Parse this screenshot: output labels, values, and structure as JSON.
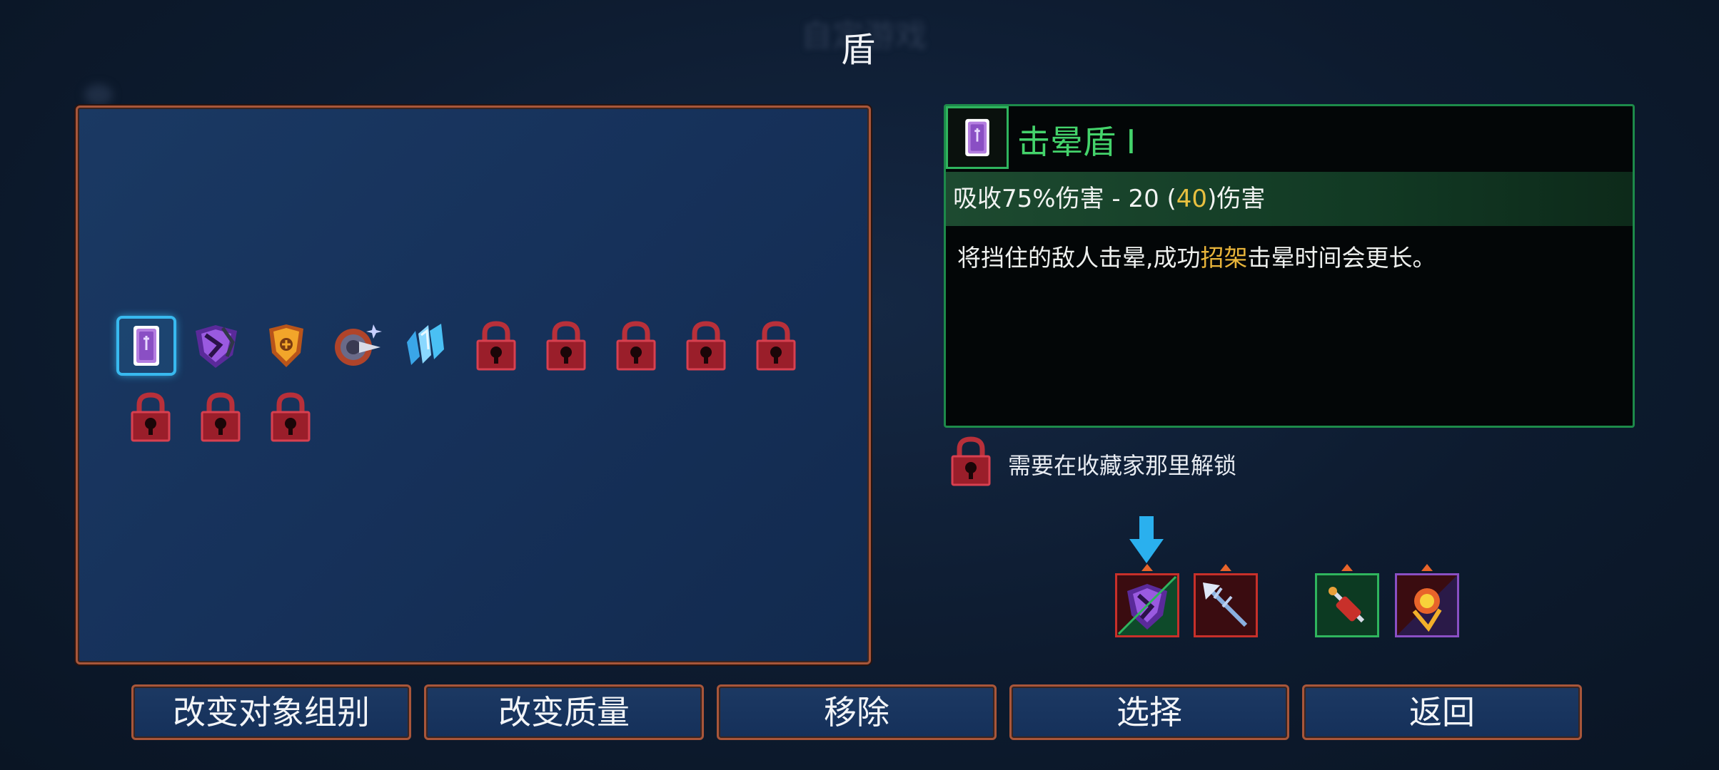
{
  "header": {
    "title": "盾"
  },
  "grid": {
    "items": [
      {
        "id": "stun-shield",
        "name": "stun-shield-icon",
        "locked": false,
        "selected": true
      },
      {
        "id": "shield-2",
        "name": "dark-purple-shield-icon",
        "locked": false
      },
      {
        "id": "shield-3",
        "name": "gold-shield-icon",
        "locked": false
      },
      {
        "id": "shield-4",
        "name": "spiked-round-shield-icon",
        "locked": false
      },
      {
        "id": "shield-5",
        "name": "ice-shield-icon",
        "locked": false
      },
      {
        "id": "lock-1",
        "name": "locked-slot-icon",
        "locked": true
      },
      {
        "id": "lock-2",
        "name": "locked-slot-icon",
        "locked": true
      },
      {
        "id": "lock-3",
        "name": "locked-slot-icon",
        "locked": true
      },
      {
        "id": "lock-4",
        "name": "locked-slot-icon",
        "locked": true
      },
      {
        "id": "lock-5",
        "name": "locked-slot-icon",
        "locked": true
      },
      {
        "id": "lock-6",
        "name": "locked-slot-icon",
        "locked": true
      },
      {
        "id": "lock-7",
        "name": "locked-slot-icon",
        "locked": true
      },
      {
        "id": "lock-8",
        "name": "locked-slot-icon",
        "locked": true
      }
    ]
  },
  "detail": {
    "name": "击晕盾 Ⅰ",
    "stat_prefix": "吸收75%伤害 - 20 (",
    "stat_highlight": "40",
    "stat_suffix": ")伤害",
    "desc_prefix": "将挡住的敌人击晕,成功",
    "desc_highlight": "招架",
    "desc_suffix": "击晕时间会更长。"
  },
  "unlock": {
    "text": "需要在收藏家那里解锁"
  },
  "equipment": [
    {
      "name": "equipped-shield-icon"
    },
    {
      "name": "equipped-spear-icon"
    },
    {
      "name": "equipped-grenade-icon"
    },
    {
      "name": "equipped-fire-skill-icon"
    }
  ],
  "buttons": {
    "change_group": "改变对象组别",
    "change_quality": "改变质量",
    "remove": "移除",
    "select": "选择",
    "back": "返回"
  },
  "colors": {
    "accent_green": "#44d36b",
    "highlight": "#e8c040",
    "frame": "#a8563a",
    "select_blue": "#38b9ef"
  }
}
